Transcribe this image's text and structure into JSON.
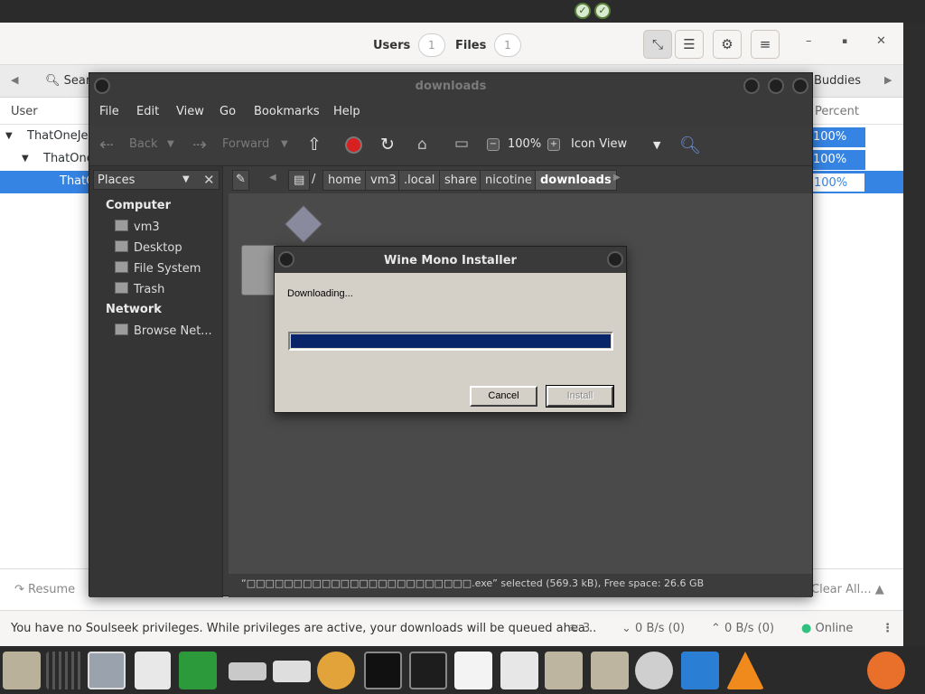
{
  "nicotine": {
    "header": {
      "users_label": "Users",
      "users_count": "1",
      "files_label": "Files",
      "files_count": "1"
    },
    "subbar": {
      "search_label": "Sear",
      "buddies_label": "Buddies"
    },
    "columns": {
      "user": "User",
      "percent": "Percent"
    },
    "rows": [
      {
        "user": "ThatOneJer",
        "percent": "100%"
      },
      {
        "user": "ThatOne",
        "percent": "100%"
      },
      {
        "user": "ThatC",
        "percent": "100%"
      }
    ],
    "footer": {
      "resume": "Resume",
      "clear_all": "Clear All..."
    },
    "status": {
      "privileges": "You have no Soulseek privileges. While privileges are active, your downloads will be queued ahea...",
      "connections": "3",
      "download_speed": "0 B/s (0)",
      "upload_speed": "0 B/s (0)",
      "online": "Online"
    }
  },
  "filemanager": {
    "title": "downloads",
    "menu": [
      "File",
      "Edit",
      "View",
      "Go",
      "Bookmarks",
      "Help"
    ],
    "toolbar": {
      "back": "Back",
      "forward": "Forward",
      "zoom": "100%",
      "view_mode": "Icon View"
    },
    "sidebar": {
      "selector": "Places",
      "computer_heading": "Computer",
      "computer_items": [
        "vm3",
        "Desktop",
        "File System",
        "Trash"
      ],
      "network_heading": "Network",
      "network_items": [
        "Browse Net..."
      ]
    },
    "path": {
      "root": "/",
      "crumbs": [
        "home",
        "vm3",
        ".local",
        "share",
        "nicotine",
        "downloads"
      ]
    },
    "statusbar": "“□□□□□□□□□□□□□□□□□□□□□□□□.exe” selected (569.3 kB), Free space: 26.6 GB"
  },
  "dialog": {
    "title": "Wine Mono Installer",
    "message": "Downloading...",
    "progress": 1.0,
    "cancel": "Cancel",
    "install": "Install"
  }
}
